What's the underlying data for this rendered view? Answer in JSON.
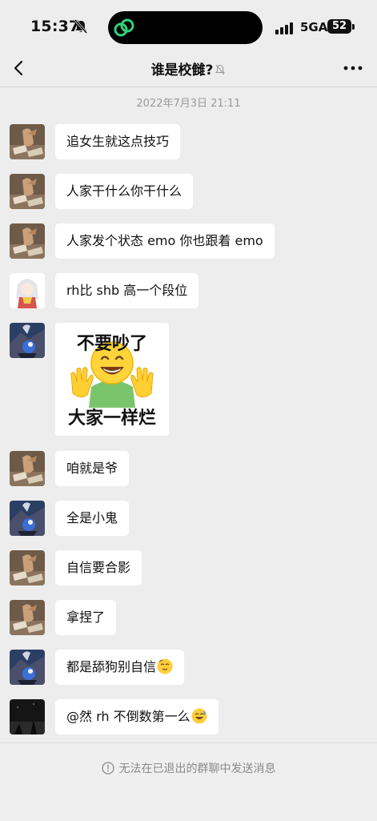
{
  "status_bar": {
    "time": "15:37",
    "network": "5GA",
    "battery": "52"
  },
  "nav": {
    "title": "谁是校雠?"
  },
  "timestamp": "2022年7月3日 21:11",
  "messages": [
    {
      "text": "追女生就这点技巧",
      "avatar": "book-avatar"
    },
    {
      "text": "人家干什么你干什么",
      "avatar": "book-avatar"
    },
    {
      "text": "人家发个状态 emo 你也跟着 emo",
      "avatar": "book-avatar"
    },
    {
      "text": "rh比 shb 高一个段位",
      "avatar": "anime-girl-avatar"
    },
    {
      "sticker_top": "不要吵了",
      "sticker_bottom": "大家一样烂",
      "avatar": "volcano-avatar"
    },
    {
      "text": "咱就是爷",
      "avatar": "book-avatar"
    },
    {
      "text": "全是小鬼",
      "avatar": "volcano-avatar"
    },
    {
      "text": "自信要合影",
      "avatar": "book-avatar"
    },
    {
      "text": "拿捏了",
      "avatar": "book-avatar"
    },
    {
      "text": "都是舔狗别自信",
      "emoji": "relieved-face",
      "avatar": "volcano-avatar"
    },
    {
      "text": "@然 rh 不倒数第一么",
      "emoji": "grinning-sweat-face",
      "avatar": "dark-night-avatar"
    }
  ],
  "footer": {
    "notice": "无法在已退出的群聊中发送消息"
  }
}
